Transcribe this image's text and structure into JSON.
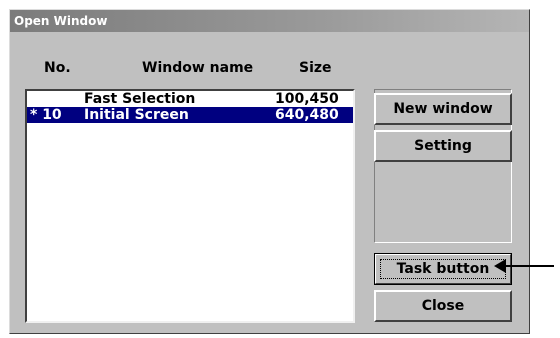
{
  "window": {
    "title": "Open Window"
  },
  "list": {
    "headers": {
      "no": "No.",
      "name": "Window name",
      "size": "Size"
    },
    "rows": [
      {
        "no": "",
        "name": "Fast Selection",
        "size": "100,450",
        "selected": false
      },
      {
        "no": "* 10",
        "name": "Initial Screen",
        "size": "640,480",
        "selected": true
      }
    ]
  },
  "buttons": {
    "new_window": "New window",
    "setting": "Setting",
    "task_button": "Task button",
    "close": "Close"
  },
  "colors": {
    "selection": "#000080",
    "dialog_face": "#c0c0c0"
  }
}
